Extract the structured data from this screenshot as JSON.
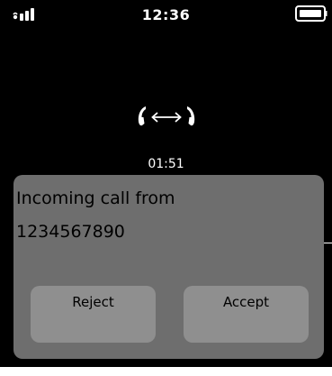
{
  "status_bar": {
    "time": "12:36",
    "signal_icon": "signal-strength-icon",
    "battery_icon": "battery-icon"
  },
  "call": {
    "icon": "call-transfer-icon",
    "duration": "01:51"
  },
  "dialog": {
    "title": "Incoming call from",
    "number": "1234567890",
    "reject_label": "Reject",
    "accept_label": "Accept"
  },
  "colors": {
    "background": "#000000",
    "dialog": "#6e6e6e",
    "button": "#8f8f8f",
    "text_light": "#ffffff",
    "text_dark": "#000000"
  }
}
